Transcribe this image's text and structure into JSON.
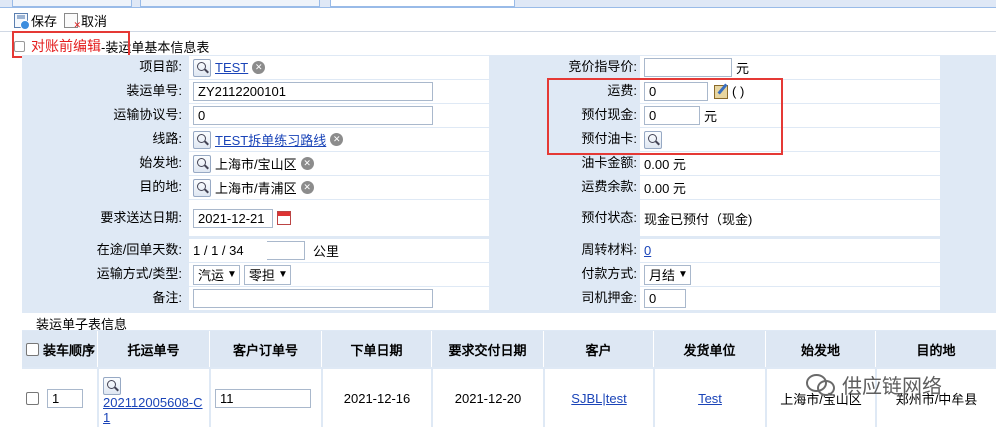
{
  "toolbar": {
    "save_label": "保存",
    "cancel_label": "取消"
  },
  "section": {
    "title_red": "对账前编辑",
    "title_rest": "-装运单基本信息表"
  },
  "left": {
    "project_label": "项目部:",
    "project_value": "TEST",
    "shipment_no_label": "装运单号:",
    "shipment_no_value": "ZY2112200101",
    "agreement_label": "运输协议号:",
    "agreement_value": "0",
    "route_label": "线路:",
    "route_value": "TEST拆单练习路线",
    "origin_label": "始发地:",
    "origin_value": "上海市/宝山区",
    "dest_label": "目的地:",
    "dest_value": "上海市/青浦区",
    "req_date_label": "要求送达日期:",
    "req_date_value": "2021-12-21",
    "days_label": "在途/回单天数:",
    "days_value": "1 / 1 / 34",
    "km_label": "公里",
    "transport_label": "运输方式/类型:",
    "transport_mode": "汽运",
    "transport_type": "零担",
    "remark_label": "备注:",
    "remark_value": ""
  },
  "right": {
    "bid_label": "竞价指导价:",
    "bid_value": "",
    "bid_unit": "元",
    "freight_label": "运费:",
    "freight_value": "0",
    "freight_paren": "( )",
    "prepaid_cash_label": "预付现金:",
    "prepaid_cash_value": "0",
    "prepaid_cash_unit": "元",
    "prepaid_fuel_label": "预付油卡:",
    "fuel_balance_label": "油卡金额:",
    "fuel_balance_value": "0.00 元",
    "freight_balance_label": "运费余款:",
    "freight_balance_value": "0.00 元",
    "prepay_status_label": "预付状态:",
    "prepay_status_value": "现金已预付（现金)",
    "turnover_label": "周转材料:",
    "turnover_value": "0",
    "payment_label": "付款方式:",
    "payment_value": "月结",
    "deposit_label": "司机押金:",
    "deposit_value": "0"
  },
  "subtable": {
    "title": "装运单子表信息",
    "headers": [
      "装车顺序",
      "托运单号",
      "客户订单号",
      "下单日期",
      "要求交付日期",
      "客户",
      "发货单位",
      "始发地",
      "目的地"
    ],
    "row": {
      "seq": "1",
      "waybill": "202112005608-C1",
      "customer_order": "11",
      "order_date": "2021-12-16",
      "due_date": "2021-12-20",
      "customer": "SJBL|test",
      "shipper": "Test",
      "origin": "上海市/宝山区",
      "dest": "郑州市/中牟县"
    }
  },
  "watermark": "供应链网络",
  "colors": {
    "highlight_box": "#e53935",
    "form_bg": "#dfe9f5",
    "link": "#1a44b8"
  }
}
